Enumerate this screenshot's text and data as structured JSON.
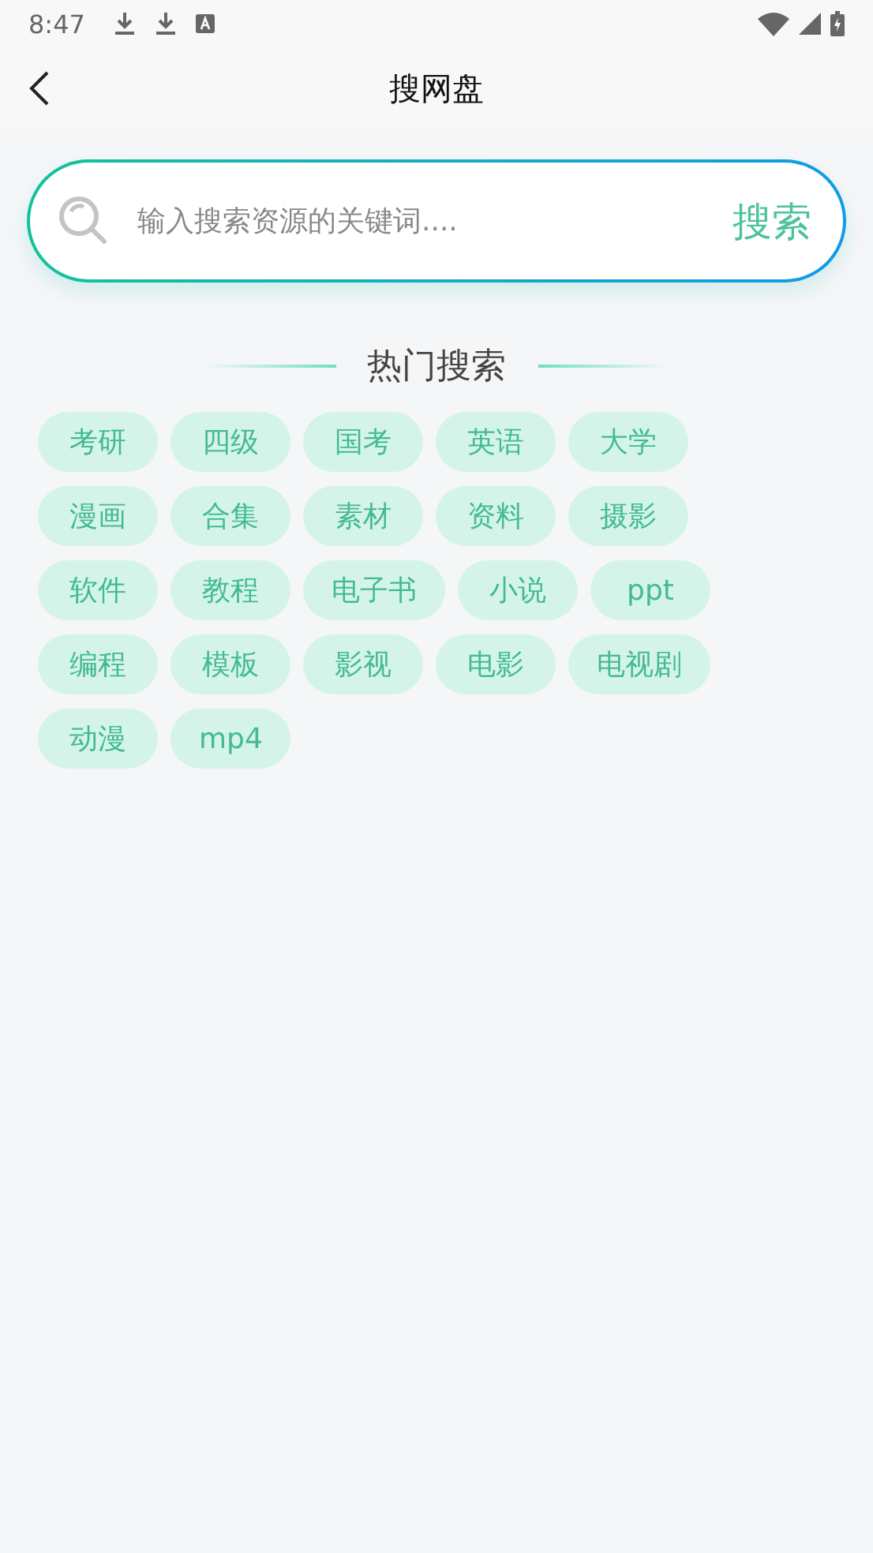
{
  "status_bar": {
    "time": "8:47"
  },
  "header": {
    "title": "搜网盘"
  },
  "search": {
    "placeholder": "输入搜索资源的关键词....",
    "button": "搜索"
  },
  "hot": {
    "title": "热门搜索",
    "tags": [
      {
        "label": "考研"
      },
      {
        "label": "四级"
      },
      {
        "label": "国考"
      },
      {
        "label": "英语"
      },
      {
        "label": "大学"
      },
      {
        "label": "漫画"
      },
      {
        "label": "合集"
      },
      {
        "label": "素材"
      },
      {
        "label": "资料"
      },
      {
        "label": "摄影"
      },
      {
        "label": "软件"
      },
      {
        "label": "教程"
      },
      {
        "label": "电子书"
      },
      {
        "label": "小说"
      },
      {
        "label": "ppt"
      },
      {
        "label": "编程"
      },
      {
        "label": "模板"
      },
      {
        "label": "影视"
      },
      {
        "label": "电影"
      },
      {
        "label": "电视剧"
      },
      {
        "label": "动漫"
      },
      {
        "label": "mp4"
      }
    ]
  }
}
